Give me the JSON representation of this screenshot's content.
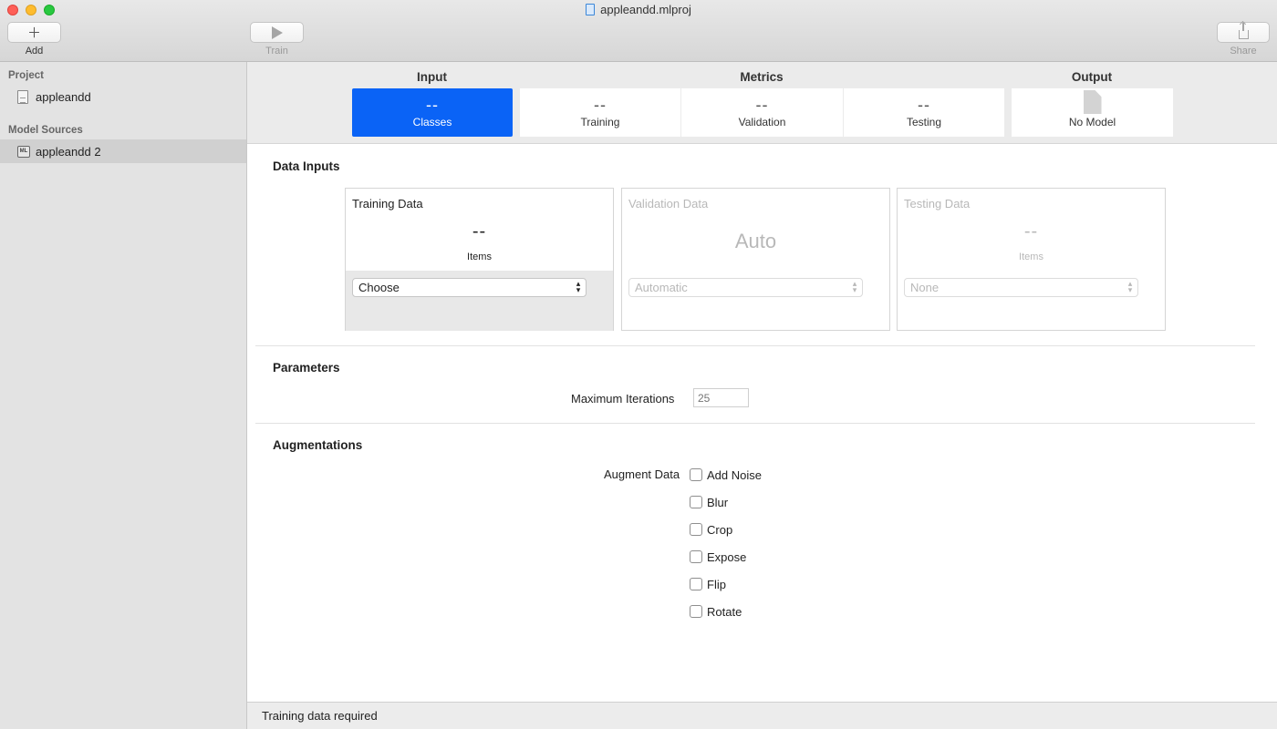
{
  "window": {
    "title": "appleandd.mlproj"
  },
  "toolbar": {
    "add_label": "Add",
    "train_label": "Train",
    "share_label": "Share"
  },
  "sidebar": {
    "project_header": "Project",
    "project_item": "appleandd",
    "sources_header": "Model Sources",
    "source_item": "appleandd 2",
    "source_icon_text": "ML"
  },
  "topbar": {
    "input_title": "Input",
    "metrics_title": "Metrics",
    "output_title": "Output",
    "classes": {
      "value": "--",
      "label": "Classes"
    },
    "training": {
      "value": "--",
      "label": "Training"
    },
    "validation": {
      "value": "--",
      "label": "Validation"
    },
    "testing": {
      "value": "--",
      "label": "Testing"
    },
    "output": {
      "label": "No Model"
    }
  },
  "data_inputs": {
    "title": "Data Inputs",
    "training": {
      "title": "Training Data",
      "value": "--",
      "unit": "Items",
      "select": "Choose"
    },
    "validation": {
      "title": "Validation Data",
      "value": "Auto",
      "select": "Automatic"
    },
    "testing": {
      "title": "Testing Data",
      "value": "--",
      "unit": "Items",
      "select": "None"
    }
  },
  "parameters": {
    "title": "Parameters",
    "max_iterations_label": "Maximum Iterations",
    "max_iterations_placeholder": "25"
  },
  "augmentations": {
    "title": "Augmentations",
    "label": "Augment Data",
    "options": [
      "Add Noise",
      "Blur",
      "Crop",
      "Expose",
      "Flip",
      "Rotate"
    ]
  },
  "status": {
    "text": "Training data required"
  },
  "colors": {
    "accent": "#0a63f6"
  }
}
